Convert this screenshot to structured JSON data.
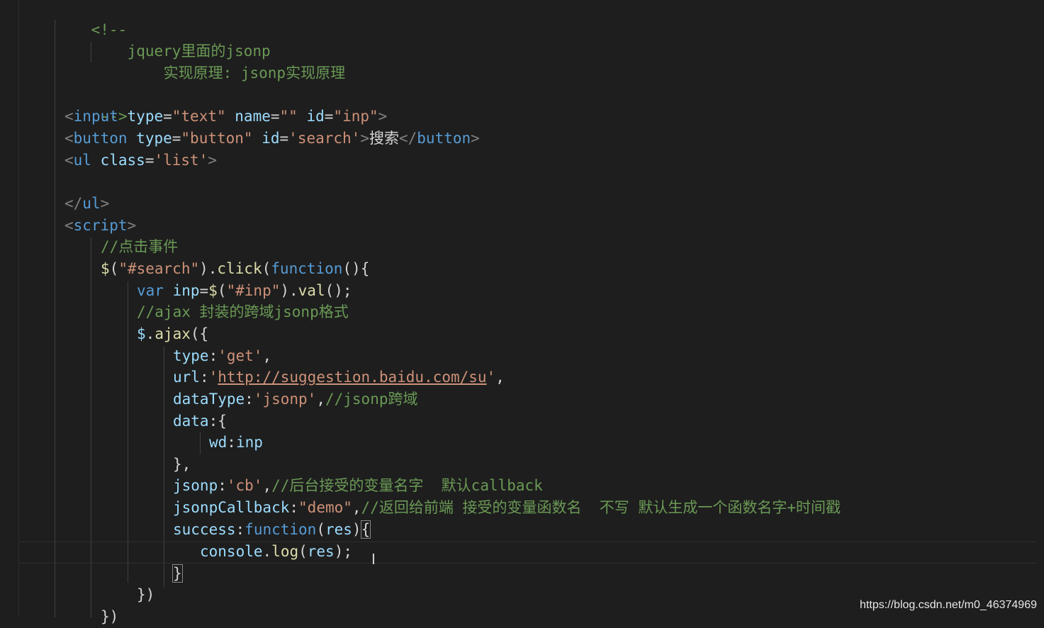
{
  "code": {
    "l1": {
      "open": "<!--"
    },
    "l2": {
      "text": "jquery里面的jsonp"
    },
    "l3": {
      "text": "实现原理: jsonp实现原理"
    },
    "l5": {
      "close": "-->"
    },
    "l6": {
      "lt": "<",
      "tag": "input",
      "a1": "type",
      "eq1": "=",
      "v1": "\"text\"",
      "a2": "name",
      "eq2": "=",
      "v2": "\"\"",
      "a3": "id",
      "eq3": "=",
      "v3": "\"inp\"",
      "gt": ">"
    },
    "l7": {
      "lt": "<",
      "tag": "button",
      "a1": "type",
      "eq1": "=",
      "v1": "\"button\"",
      "a2": "id",
      "eq2": "=",
      "v2": "'search'",
      "gt": ">",
      "text": "搜索",
      "clt": "</",
      "ctag": "button",
      "cgt": ">"
    },
    "l8": {
      "lt": "<",
      "tag": "ul",
      "a1": "class",
      "eq1": "=",
      "v1": "'list'",
      "gt": ">"
    },
    "l10": {
      "lt": "</",
      "tag": "ul",
      "gt": ">"
    },
    "l11": {
      "lt": "<",
      "tag": "script",
      "gt": ">"
    },
    "l12": {
      "comment": "//点击事件"
    },
    "l13": {
      "dollar": "$",
      "p1": "(",
      "sel": "\"#search\"",
      "p2": ").",
      "fn": "click",
      "p3": "(",
      "kw": "function",
      "p4": "(){"
    },
    "l14": {
      "kw": "var",
      "sp": " ",
      "v": "inp",
      "eq": "=",
      "dollar": "$",
      "p1": "(",
      "sel": "\"#inp\"",
      "p2": ").",
      "fn": "val",
      "p3": "();"
    },
    "l15": {
      "comment": "//ajax 封装的跨域jsonp格式"
    },
    "l16": {
      "dollar": "$",
      "dot": ".",
      "fn": "ajax",
      "p": "({"
    },
    "l17": {
      "k": "type",
      "colon": ":",
      "v": "'get'",
      "comma": ","
    },
    "l18": {
      "k": "url",
      "colon": ":",
      "q1": "'",
      "url": "http://suggestion.baidu.com/su",
      "q2": "'",
      "comma": ","
    },
    "l19": {
      "k": "dataType",
      "colon": ":",
      "v": "'jsonp'",
      "comma": ",",
      "comment": "//jsonp跨域"
    },
    "l20": {
      "k": "data",
      "colon": ":",
      "p": "{"
    },
    "l21": {
      "k": "wd",
      "colon": ":",
      "v": "inp"
    },
    "l22": {
      "p": "},"
    },
    "l23": {
      "k": "jsonp",
      "colon": ":",
      "v": "'cb'",
      "comma": ",",
      "comment": "//后台接受的变量名字  默认callback"
    },
    "l24": {
      "k": "jsonpCallback",
      "colon": ":",
      "v": "\"demo\"",
      "comma": ",",
      "comment": "//返回给前端 接受的变量函数名  不写 默认生成一个函数名字+时间戳"
    },
    "l25": {
      "k": "success",
      "colon": ":",
      "kw": "function",
      "p1": "(",
      "arg": "res",
      "p2": ")",
      "brace": "{"
    },
    "l26": {
      "obj": "console",
      "dot": ".",
      "fn": "log",
      "p1": "(",
      "arg": "res",
      "p2": ");"
    },
    "l27": {
      "brace": "}"
    },
    "l28": {
      "p": "})"
    },
    "l29": {
      "p": "})"
    }
  },
  "cursor": {
    "glyph": "I"
  },
  "watermark": "https://blog.csdn.net/m0_46374969"
}
